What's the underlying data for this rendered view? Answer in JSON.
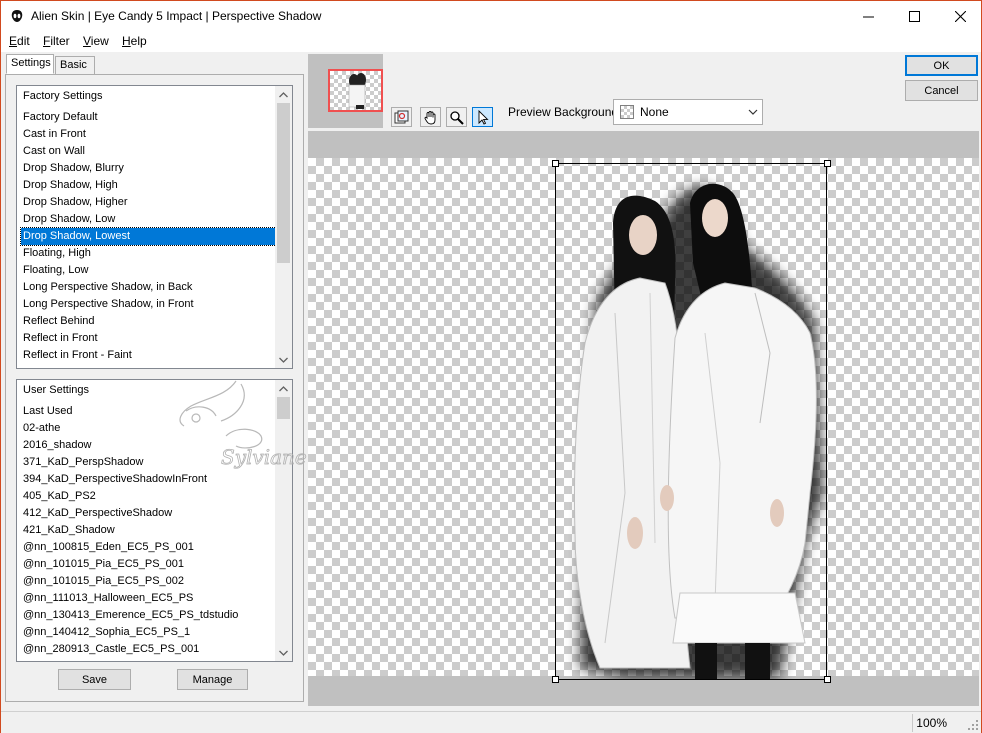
{
  "window": {
    "title": "Alien Skin | Eye Candy 5 Impact | Perspective Shadow"
  },
  "menu": [
    {
      "label": "Edit",
      "key": "E",
      "rest": "dit"
    },
    {
      "label": "Filter",
      "key": "F",
      "rest": "ilter"
    },
    {
      "label": "View",
      "key": "V",
      "rest": "iew"
    },
    {
      "label": "Help",
      "key": "H",
      "rest": "elp"
    }
  ],
  "tabs": {
    "settings": "Settings",
    "basic": "Basic"
  },
  "factory": {
    "header": "Factory Settings",
    "items": [
      "Factory Default",
      "Cast in Front",
      "Cast on Wall",
      "Drop Shadow, Blurry",
      "Drop Shadow, High",
      "Drop Shadow, Higher",
      "Drop Shadow, Low",
      "Drop Shadow, Lowest",
      "Floating, High",
      "Floating, Low",
      "Long Perspective Shadow, in Back",
      "Long Perspective Shadow, in Front",
      "Reflect Behind",
      "Reflect in Front",
      "Reflect in Front - Faint"
    ],
    "selected": "Drop Shadow, Lowest"
  },
  "user": {
    "header": "User Settings",
    "items": [
      "Last Used",
      "02-athe",
      "2016_shadow",
      "371_KaD_PerspShadow",
      "394_KaD_PerspectiveShadowInFront",
      "405_KaD_PS2",
      "412_KaD_PerspectiveShadow",
      "421_KaD_Shadow",
      "@nn_100815_Eden_EC5_PS_001",
      "@nn_101015_Pia_EC5_PS_001",
      "@nn_101015_Pia_EC5_PS_002",
      "@nn_111013_Halloween_EC5_PS",
      "@nn_130413_Emerence_EC5_PS_tdstudio",
      "@nn_140412_Sophia_EC5_PS_1",
      "@nn_280913_Castle_EC5_PS_001"
    ]
  },
  "buttons": {
    "save": "Save",
    "manage": "Manage",
    "ok": "OK",
    "cancel": "Cancel"
  },
  "preview_background": {
    "label": "Preview Background:",
    "value": "None"
  },
  "status": {
    "zoom": "100%"
  },
  "colors": {
    "accent": "#0078d7",
    "window_border": "#d14a1f",
    "thumb_frame": "#f05050"
  }
}
